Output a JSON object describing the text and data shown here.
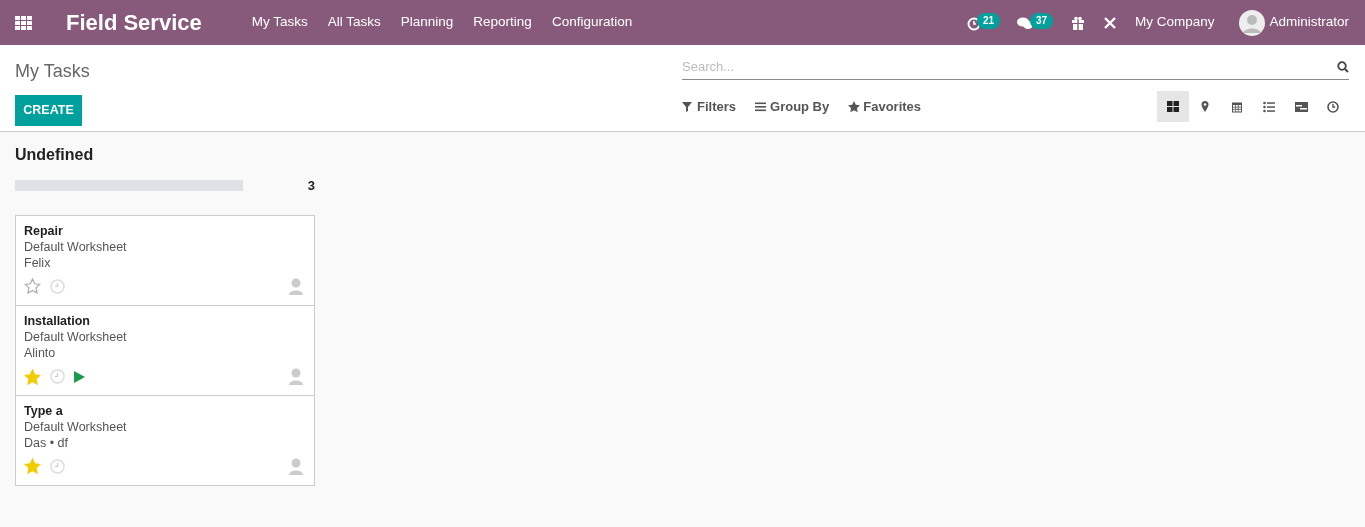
{
  "navbar": {
    "app_title": "Field Service",
    "menu": [
      "My Tasks",
      "All Tasks",
      "Planning",
      "Reporting",
      "Configuration"
    ],
    "activity_count": "21",
    "message_count": "37",
    "company": "My Company",
    "user": "Administrator"
  },
  "control_panel": {
    "breadcrumb": "My Tasks",
    "create_button": "CREATE",
    "search": {
      "placeholder": "Search..."
    },
    "filters": [
      "Filters",
      "Group By",
      "Favorites"
    ],
    "views": [
      {
        "kind": "kanban",
        "selected": true
      },
      {
        "kind": "map",
        "selected": false
      },
      {
        "kind": "calendar",
        "selected": false
      },
      {
        "kind": "list",
        "selected": false
      },
      {
        "kind": "gantt",
        "selected": false
      },
      {
        "kind": "activity",
        "selected": false
      }
    ]
  },
  "columns": [
    {
      "title": "Undefined",
      "count": "3",
      "level": 0,
      "cards": [
        {
          "title": "Repair",
          "worksheet": "Default Worksheet",
          "customer": "Felix",
          "starred": false,
          "timer_running": false
        },
        {
          "title": "Installation",
          "worksheet": "Default Worksheet",
          "customer": "Alinto",
          "starred": true,
          "timer_running": true
        },
        {
          "title": "Type a",
          "worksheet": "Default Worksheet",
          "customer": "Das • df",
          "starred": true,
          "timer_running": false
        }
      ]
    }
  ]
}
